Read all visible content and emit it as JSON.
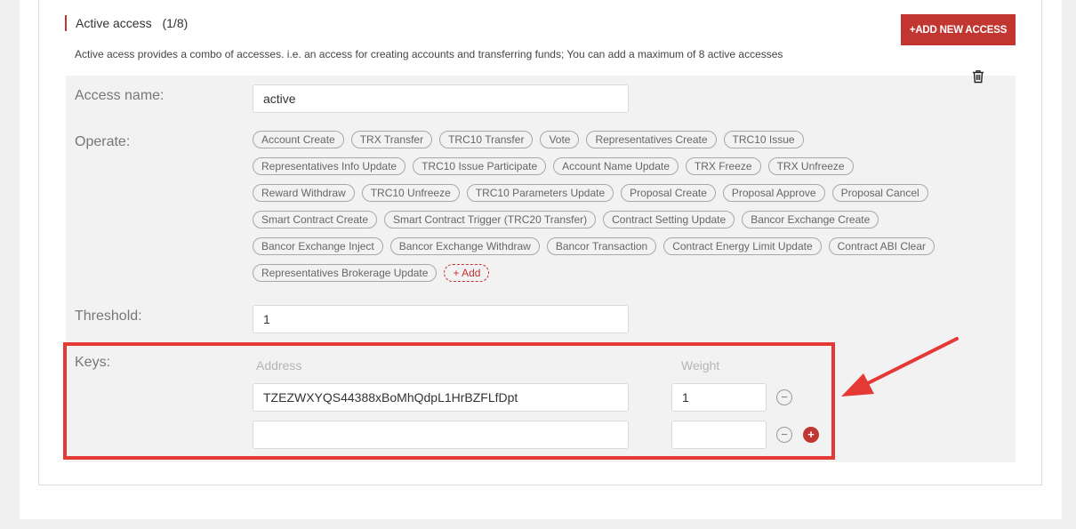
{
  "access": {
    "title": "Active access",
    "count": "(1/8)",
    "add_button": "+ADD NEW ACCESS",
    "description": "Active acess provides a combo of accesses. i.e. an access for creating accounts and transferring funds; You can add a maximum of 8 active accesses"
  },
  "form": {
    "access_name_label": "Access name:",
    "access_name_value": "active",
    "operate_label": "Operate:",
    "threshold_label": "Threshold:",
    "threshold_value": "1",
    "keys_label": "Keys:"
  },
  "operations": [
    [
      "Account Create",
      "TRX Transfer",
      "TRC10 Transfer",
      "Vote",
      "Representatives Create",
      "TRC10 Issue"
    ],
    [
      "Representatives Info Update",
      "TRC10 Issue Participate",
      "Account Name Update",
      "TRX Freeze",
      "TRX Unfreeze"
    ],
    [
      "Reward Withdraw",
      "TRC10 Unfreeze",
      "TRC10 Parameters Update",
      "Proposal Create",
      "Proposal Approve",
      "Proposal Cancel"
    ],
    [
      "Smart Contract Create",
      "Smart Contract Trigger (TRC20 Transfer)",
      "Contract Setting Update",
      "Bancor Exchange Create"
    ],
    [
      "Bancor Exchange Inject",
      "Bancor Exchange Withdraw",
      "Bancor Transaction",
      "Contract Energy Limit Update",
      "Contract ABI Clear"
    ],
    [
      "Representatives Brokerage Update"
    ]
  ],
  "add_operation_label": "+ Add",
  "keys": {
    "address_header": "Address",
    "weight_header": "Weight",
    "rows": [
      {
        "address": "TZEZWXYQS44388xBoMhQdpL1HrBZFLfDpt",
        "weight": "1"
      },
      {
        "address": "",
        "weight": ""
      }
    ],
    "minus_symbol": "−",
    "plus_symbol": "+"
  },
  "colors": {
    "accent": "#c23631",
    "highlight": "#e53935"
  },
  "icons": {
    "trash": "trash-icon",
    "arrow": "annotation-arrow"
  }
}
